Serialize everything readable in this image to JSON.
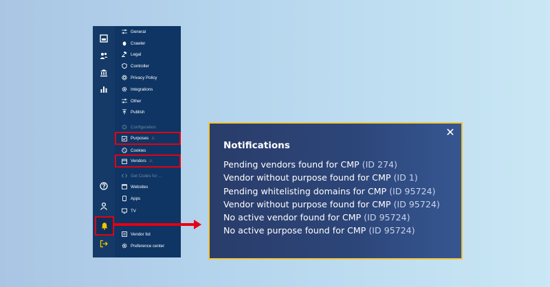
{
  "rail": {
    "icons": [
      "dashboard-icon",
      "users-icon",
      "bank-icon",
      "bar-chart-icon"
    ],
    "bottom_icons": [
      "help-icon",
      "user-icon",
      "bell-icon",
      "logout-icon"
    ]
  },
  "menu": {
    "items": [
      {
        "label": "General",
        "icon": "sliders-icon"
      },
      {
        "label": "Crawler",
        "icon": "bug-icon"
      },
      {
        "label": "Legal",
        "icon": "gavel-icon"
      },
      {
        "label": "Controller",
        "icon": "shield-icon"
      },
      {
        "label": "Privacy Policy",
        "icon": "fingerprint-icon"
      },
      {
        "label": "Integrations",
        "icon": "gear-icon"
      },
      {
        "label": "Other",
        "icon": "sliders-icon"
      },
      {
        "label": "Publish",
        "icon": "upload-icon"
      }
    ],
    "config_heading": "Configuration",
    "config_items": [
      {
        "label": "Purposes",
        "icon": "check-square-icon",
        "warning": "⚠"
      },
      {
        "label": "Cookies",
        "icon": "cookie-icon"
      },
      {
        "label": "Vendors",
        "icon": "store-icon",
        "warning": "⚠"
      }
    ],
    "code_heading": "Get Codes for ...",
    "code_items": [
      {
        "label": "Websites",
        "icon": "browser-icon"
      },
      {
        "label": "Apps",
        "icon": "apps-icon"
      },
      {
        "label": "TV",
        "icon": "tv-icon"
      }
    ],
    "bottom_items": [
      {
        "label": "Vendor list",
        "icon": "list-icon"
      },
      {
        "label": "Preference center",
        "icon": "gear-icon"
      }
    ]
  },
  "notifications": {
    "title": "Notifications",
    "close_glyph": "✕",
    "items": [
      {
        "text": "Pending vendors found for CMP",
        "id": "(ID 274)"
      },
      {
        "text": "Vendor without purpose found for CMP",
        "id": "(ID 1)"
      },
      {
        "text": "Pending whitelisting domains for CMP",
        "id": "(ID 95724)"
      },
      {
        "text": "Vendor without purpose found for CMP",
        "id": "(ID 95724)"
      },
      {
        "text": "No active vendor found for CMP",
        "id": "(ID 95724)"
      },
      {
        "text": "No active purpose found for CMP",
        "id": "(ID 95724)"
      }
    ]
  },
  "colors": {
    "rail": "#153a68",
    "menu": "#0e3564",
    "highlight": "#e60012",
    "panel_border": "#f2c43d"
  }
}
